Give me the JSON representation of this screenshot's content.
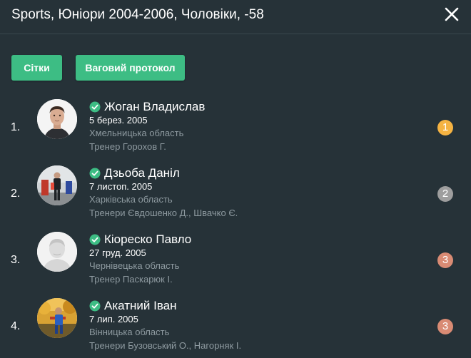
{
  "header": {
    "title": "Sports, Юніори 2004-2006, Чоловіки, -58"
  },
  "buttons": {
    "grids": "Сітки",
    "weigh_protocol": "Ваговий протокол"
  },
  "colors": {
    "background": "#263238",
    "button": "#3dbd84",
    "check": "#3dbd84",
    "muted_text": "#8e9aa0",
    "gold": "#f5b342",
    "silver": "#9e9e9e",
    "bronze": "#d98b74"
  },
  "athletes": [
    {
      "place": "1.",
      "name": "Жоган Владислав",
      "dob": "5 берез. 2005",
      "region": "Хмельницька область",
      "coach": "Тренер Горохов Г.",
      "medal": "1",
      "medal_color": "#f5b342",
      "avatar_icon": "photo-portrait"
    },
    {
      "place": "2.",
      "name": "Дзьоба Даніл",
      "dob": "7 листоп. 2005",
      "region": "Харківська область",
      "coach": "Тренери Євдошенко Д.,  Швачко Є.",
      "medal": "2",
      "medal_color": "#9e9e9e",
      "avatar_icon": "photo-full-body"
    },
    {
      "place": "3.",
      "name": "Кіореско Павло",
      "dob": "27 груд. 2005",
      "region": "Чернівецька область",
      "coach": "Тренер Паскарюк І.",
      "medal": "3",
      "medal_color": "#d98b74",
      "avatar_icon": "default-avatar"
    },
    {
      "place": "4.",
      "name": "Акатний Іван",
      "dob": "7 лип. 2005",
      "region": "Вінницька область",
      "coach": "Тренери Бузовський О.,  Нагорняк І.",
      "medal": "3",
      "medal_color": "#d98b74",
      "avatar_icon": "photo-outdoor"
    }
  ]
}
